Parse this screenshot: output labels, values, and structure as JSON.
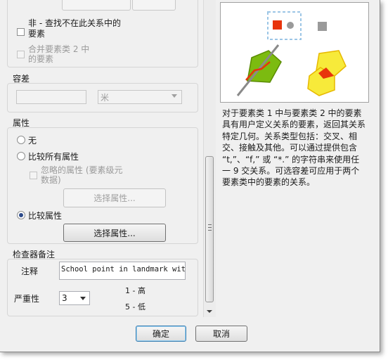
{
  "dialog": {
    "filter": {
      "not_checkbox_label": "非 - 查找不在此关系中的要素",
      "merge_checkbox_label": "合并要素类 2 中的要素"
    },
    "tolerance": {
      "section_title": "容差",
      "value": "",
      "unit": "米"
    },
    "attributes": {
      "section_title": "属性",
      "option_none": "无",
      "option_compare_all": "比较所有属性",
      "ignored_checkbox_label": "忽略的属性 (要素级元数据)",
      "select_button_disabled": "选择属性...",
      "option_compare": "比较属性",
      "select_button": "选择属性..."
    },
    "inspector": {
      "section_title": "检查器备注",
      "note_label": "注释",
      "note_value": "School point in landmark with",
      "severity_label": "严重性",
      "severity_value": "3",
      "severity_hint_high": "1 - 高",
      "severity_hint_low": "5 - 低"
    },
    "description": "对于要素类 1 中与要素类 2 中的要素具有用户定义关系的要素，返回其关系特定几何。关系类型包括：交叉、相交、接触及其他。可以通过提供包含 “t,”、“f,” 或 “*.” 的字符串来使用任一 9 交关系。可选容差可应用于两个要素类中的要素的关系。",
    "buttons": {
      "ok": "确定",
      "cancel": "取消"
    },
    "colors": {
      "accent_red": "#e8340c",
      "green_polygon": "#7cbb10",
      "yellow_polygon": "#f7ea3a",
      "selection_blue": "#9cc6e6"
    }
  }
}
